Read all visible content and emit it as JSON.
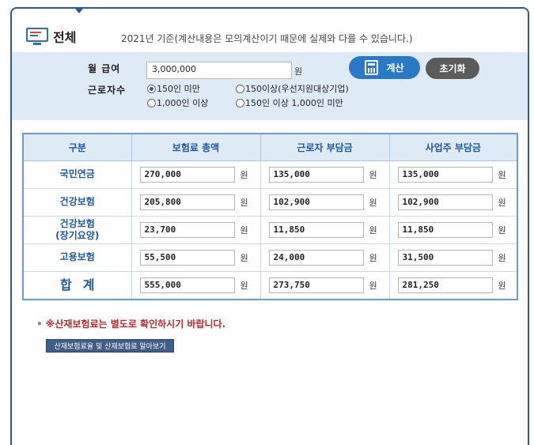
{
  "header": {
    "title": "전체",
    "notice": "2021년 기준(계산내용은 모의계산이기 때문에 실제와 다를 수 있습니다.)"
  },
  "form": {
    "wage_label": "월 급여",
    "wage_value": "3,000,000",
    "wage_unit": "원",
    "workers_label": "근로자수",
    "options": [
      "150인 미만",
      "150이상(우선지원대상기업)",
      "1,000인 이상",
      "150인 이상 1,000인 미만"
    ],
    "selected_option": "150인 미만",
    "calc_label": "계산",
    "reset_label": "초기화"
  },
  "table": {
    "headers": [
      "구분",
      "보험료 총액",
      "근로자 부담금",
      "사업주 부담금"
    ],
    "unit": "원",
    "rows": [
      {
        "name": "국민연금",
        "total": "270,000",
        "worker": "135,000",
        "employer": "135,000"
      },
      {
        "name": "건강보험",
        "total": "205,800",
        "worker": "102,900",
        "employer": "102,900"
      },
      {
        "name": "건강보험",
        "name2": "(장기요양)",
        "total": "23,700",
        "worker": "11,850",
        "employer": "11,850"
      },
      {
        "name": "고용보험",
        "total": "55,500",
        "worker": "24,000",
        "employer": "31,500"
      },
      {
        "name": "합계",
        "total": "555,000",
        "worker": "273,750",
        "employer": "281,250"
      }
    ]
  },
  "footer": {
    "bullet": "•",
    "warning": "※산재보험료는 별도로 확인하시기 바랍니다.",
    "link_label": "산재보험료율 및 산재보험료 알아보기"
  }
}
